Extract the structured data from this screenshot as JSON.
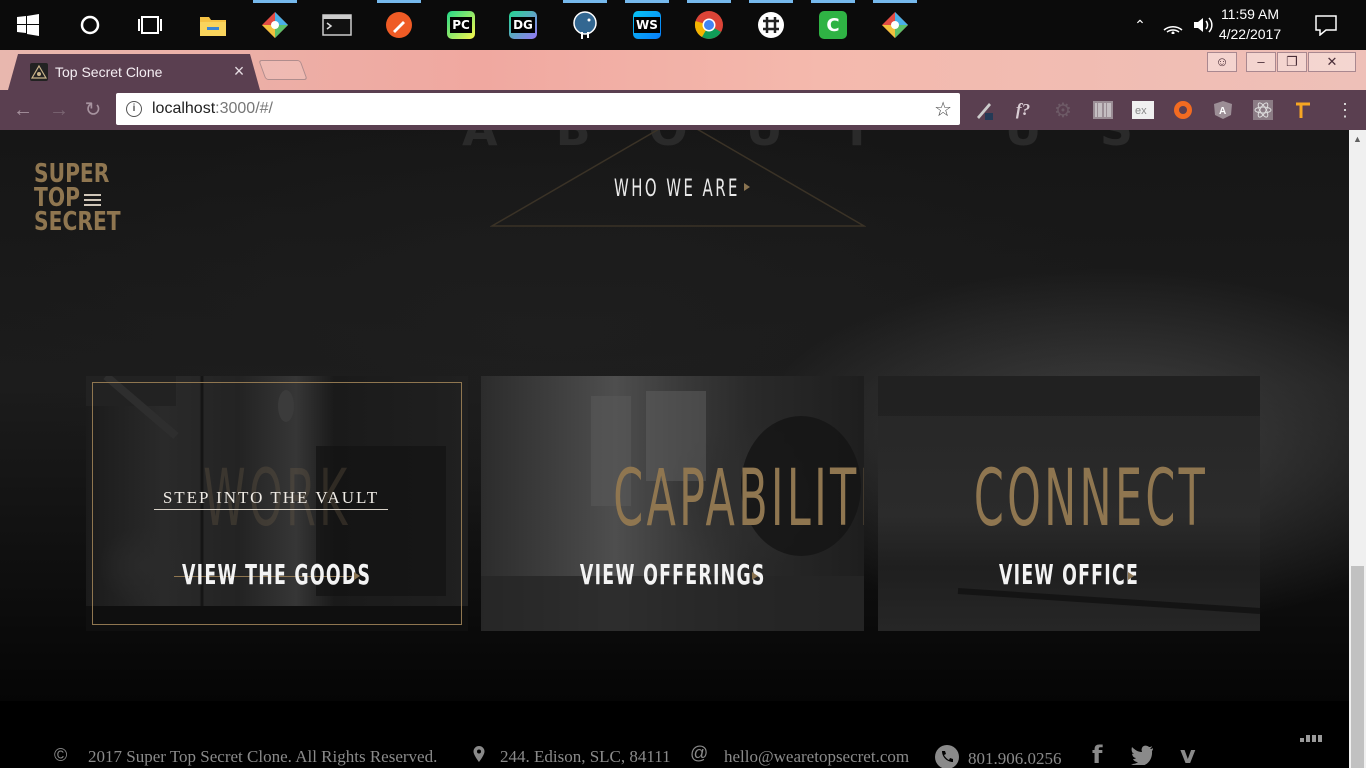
{
  "taskbar": {
    "apps": [
      "start",
      "search",
      "task-view",
      "file-explorer",
      "git-kraken",
      "terminal",
      "postman",
      "pycharm",
      "datagrip",
      "postgres",
      "webstorm",
      "chrome",
      "slack",
      "camtasia",
      "git-kraken-2"
    ],
    "clock_time": "11:59 AM",
    "clock_date": "4/22/2017"
  },
  "browser": {
    "tab_title": "Top Secret Clone",
    "url_host": "localhost",
    "url_path": ":3000/#/"
  },
  "page": {
    "logo_lines": [
      "SUPER",
      "TOP",
      "SECRET"
    ],
    "who_we_are": "WHO WE ARE",
    "cards": [
      {
        "title": "WORK",
        "tagline": "STEP INTO THE VAULT",
        "link": "VIEW THE GOODS"
      },
      {
        "title": "CAPABILITIES",
        "link": "VIEW OFFERINGS"
      },
      {
        "title": "CONNECT",
        "link": "VIEW OFFICE"
      }
    ],
    "colors": {
      "gold": "#8f7650",
      "text": "#f3f3f3"
    }
  },
  "footer": {
    "copyright": "2017 Super Top Secret Clone. All Rights Reserved.",
    "address": "244. Edison, SLC, 84111",
    "email": "hello@wearetopsecret.com",
    "phone": "801.906.0256"
  }
}
